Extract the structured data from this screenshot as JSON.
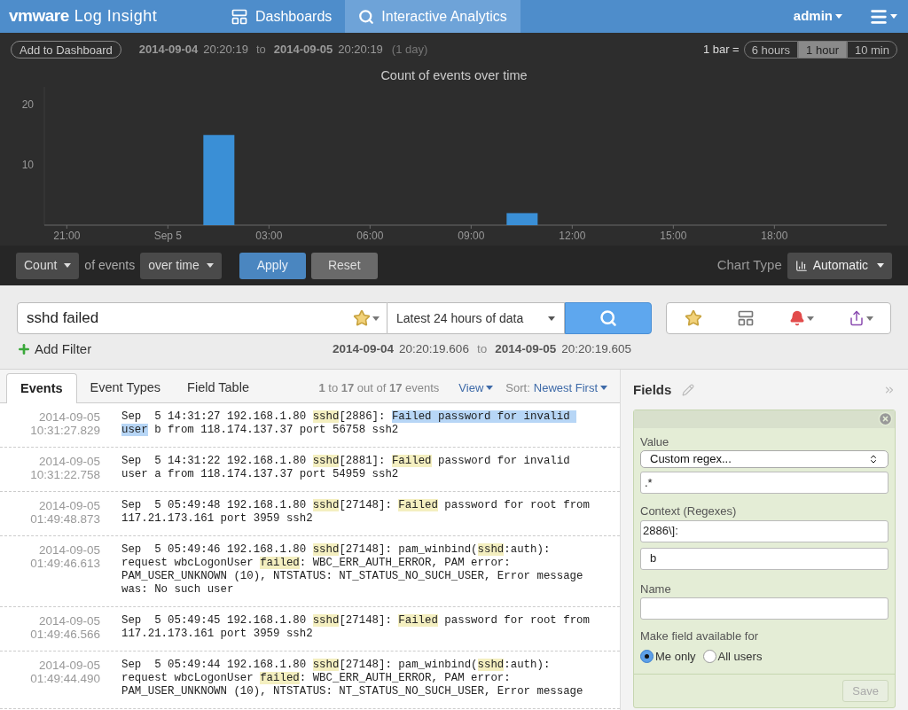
{
  "header": {
    "logo_brand": "vmware",
    "logo_product": "Log Insight",
    "nav": [
      {
        "label": "Dashboards",
        "kind": "dashboards",
        "selected": false
      },
      {
        "label": "Interactive Analytics",
        "kind": "search",
        "selected": true
      }
    ],
    "user": "admin"
  },
  "toolbar": {
    "add_button": "Add to Dashboard",
    "range": {
      "start_date": "2014-09-04",
      "start_time": "20:20:19",
      "to": "to",
      "end_date": "2014-09-05",
      "end_time": "20:20:19",
      "duration": "(1 day)"
    },
    "bar_label": "1 bar =",
    "bar_options": [
      {
        "label": "6 hours",
        "selected": false
      },
      {
        "label": "1 hour",
        "selected": true
      },
      {
        "label": "10 min",
        "selected": false
      }
    ]
  },
  "chart": {
    "chart_data": {
      "type": "bar",
      "title": "Count of events over time",
      "categories": [
        null,
        "21:00",
        null,
        null,
        "Sep 5",
        null,
        null,
        "03:00",
        null,
        null,
        "06:00",
        null,
        null,
        "09:00",
        null,
        null,
        "12:00",
        null,
        null,
        "15:00",
        null,
        null,
        "18:00",
        null
      ],
      "series": [
        {
          "color": "#3a8fd6",
          "values": [
            0,
            0,
            0,
            0,
            0,
            15,
            0,
            0,
            0,
            0,
            0,
            0,
            0,
            0,
            2,
            0,
            0,
            0,
            0,
            0,
            0,
            0,
            0,
            0
          ]
        }
      ],
      "ylim": [
        0,
        23
      ],
      "yticks": [
        10,
        20
      ]
    }
  },
  "query": {
    "function": "Count",
    "of_label": "of events",
    "grouping": "over time",
    "apply": "Apply",
    "reset": "Reset",
    "chart_type_label": "Chart Type",
    "chart_type": "Automatic"
  },
  "search": {
    "value": "sshd failed",
    "time_range": "Latest 24 hours of data",
    "add_filter": "Add Filter",
    "range": {
      "start_date": "2014-09-04",
      "start_time": "20:20:19.606",
      "to": "to",
      "end_date": "2014-09-05",
      "end_time": "20:20:19.605"
    }
  },
  "results": {
    "tabs": [
      {
        "label": "Events",
        "selected": true
      },
      {
        "label": "Event Types",
        "selected": false
      },
      {
        "label": "Field Table",
        "selected": false
      }
    ],
    "summary": "**1** to **17** out of **17** events",
    "view": "View",
    "sort_label": "Sort:",
    "sort": "Newest First",
    "events": [
      {
        "date": "2014-09-05",
        "time": "10:31:27.829",
        "segments": [
          {
            "text": "Sep  5 14:31:27 192.168.1.80 ",
            "kind": "plain"
          },
          {
            "text": "sshd",
            "kind": "term"
          },
          {
            "text": "[2886]: ",
            "kind": "plain"
          },
          {
            "text": "Failed password for invalid user",
            "kind": "selection"
          },
          {
            "text": " b from 118.174.137.37 port 56758 ssh2",
            "kind": "plain"
          }
        ]
      },
      {
        "date": "2014-09-05",
        "time": "10:31:22.758",
        "segments": [
          {
            "text": "Sep  5 14:31:22 192.168.1.80 ",
            "kind": "plain"
          },
          {
            "text": "sshd",
            "kind": "term"
          },
          {
            "text": "[2881]: ",
            "kind": "plain"
          },
          {
            "text": "Failed",
            "kind": "term"
          },
          {
            "text": " password for invalid user a from 118.174.137.37 port 54959 ssh2",
            "kind": "plain"
          }
        ]
      },
      {
        "date": "2014-09-05",
        "time": "01:49:48.873",
        "segments": [
          {
            "text": "Sep  5 05:49:48 192.168.1.80 ",
            "kind": "plain"
          },
          {
            "text": "sshd",
            "kind": "term"
          },
          {
            "text": "[27148]: ",
            "kind": "plain"
          },
          {
            "text": "Failed",
            "kind": "term"
          },
          {
            "text": " password for root from 117.21.173.161 port 3959 ssh2",
            "kind": "plain"
          }
        ]
      },
      {
        "date": "2014-09-05",
        "time": "01:49:46.613",
        "segments": [
          {
            "text": "Sep  5 05:49:46 192.168.1.80 ",
            "kind": "plain"
          },
          {
            "text": "sshd",
            "kind": "term"
          },
          {
            "text": "[27148]: pam_winbind(",
            "kind": "plain"
          },
          {
            "text": "sshd",
            "kind": "term"
          },
          {
            "text": ":auth): request wbcLogonUser ",
            "kind": "plain"
          },
          {
            "text": "failed",
            "kind": "term"
          },
          {
            "text": ": WBC_ERR_AUTH_ERROR, PAM error: PAM_USER_UNKNOWN (10), NTSTATUS: NT_STATUS_NO_SUCH_USER, Error message was: No such user",
            "kind": "plain"
          }
        ]
      },
      {
        "date": "2014-09-05",
        "time": "01:49:46.566",
        "segments": [
          {
            "text": "Sep  5 05:49:45 192.168.1.80 ",
            "kind": "plain"
          },
          {
            "text": "sshd",
            "kind": "term"
          },
          {
            "text": "[27148]: ",
            "kind": "plain"
          },
          {
            "text": "Failed",
            "kind": "term"
          },
          {
            "text": " password for root from 117.21.173.161 port 3959 ssh2",
            "kind": "plain"
          }
        ]
      },
      {
        "date": "2014-09-05",
        "time": "01:49:44.490",
        "segments": [
          {
            "text": "Sep  5 05:49:44 192.168.1.80 ",
            "kind": "plain"
          },
          {
            "text": "sshd",
            "kind": "term"
          },
          {
            "text": "[27148]: pam_winbind(",
            "kind": "plain"
          },
          {
            "text": "sshd",
            "kind": "term"
          },
          {
            "text": ":auth): request wbcLogonUser ",
            "kind": "plain"
          },
          {
            "text": "failed",
            "kind": "term"
          },
          {
            "text": ": WBC_ERR_AUTH_ERROR, PAM error: PAM_USER_UNKNOWN (10), NTSTATUS: NT_STATUS_NO_SUCH_USER, Error message",
            "kind": "plain"
          }
        ]
      }
    ]
  },
  "fields_panel": {
    "title": "Fields",
    "value_label": "Value",
    "value_select": "Custom regex...",
    "value_regex": ".*",
    "context_label": "Context (Regexes)",
    "context_before": "2886\\]:",
    "context_after": "b",
    "name_label": "Name",
    "availability_label": "Make field available for",
    "availability_options": [
      {
        "label": "Me only",
        "selected": true
      },
      {
        "label": "All users",
        "selected": false
      }
    ],
    "save": {
      "label": "Save",
      "disabled": true
    }
  }
}
